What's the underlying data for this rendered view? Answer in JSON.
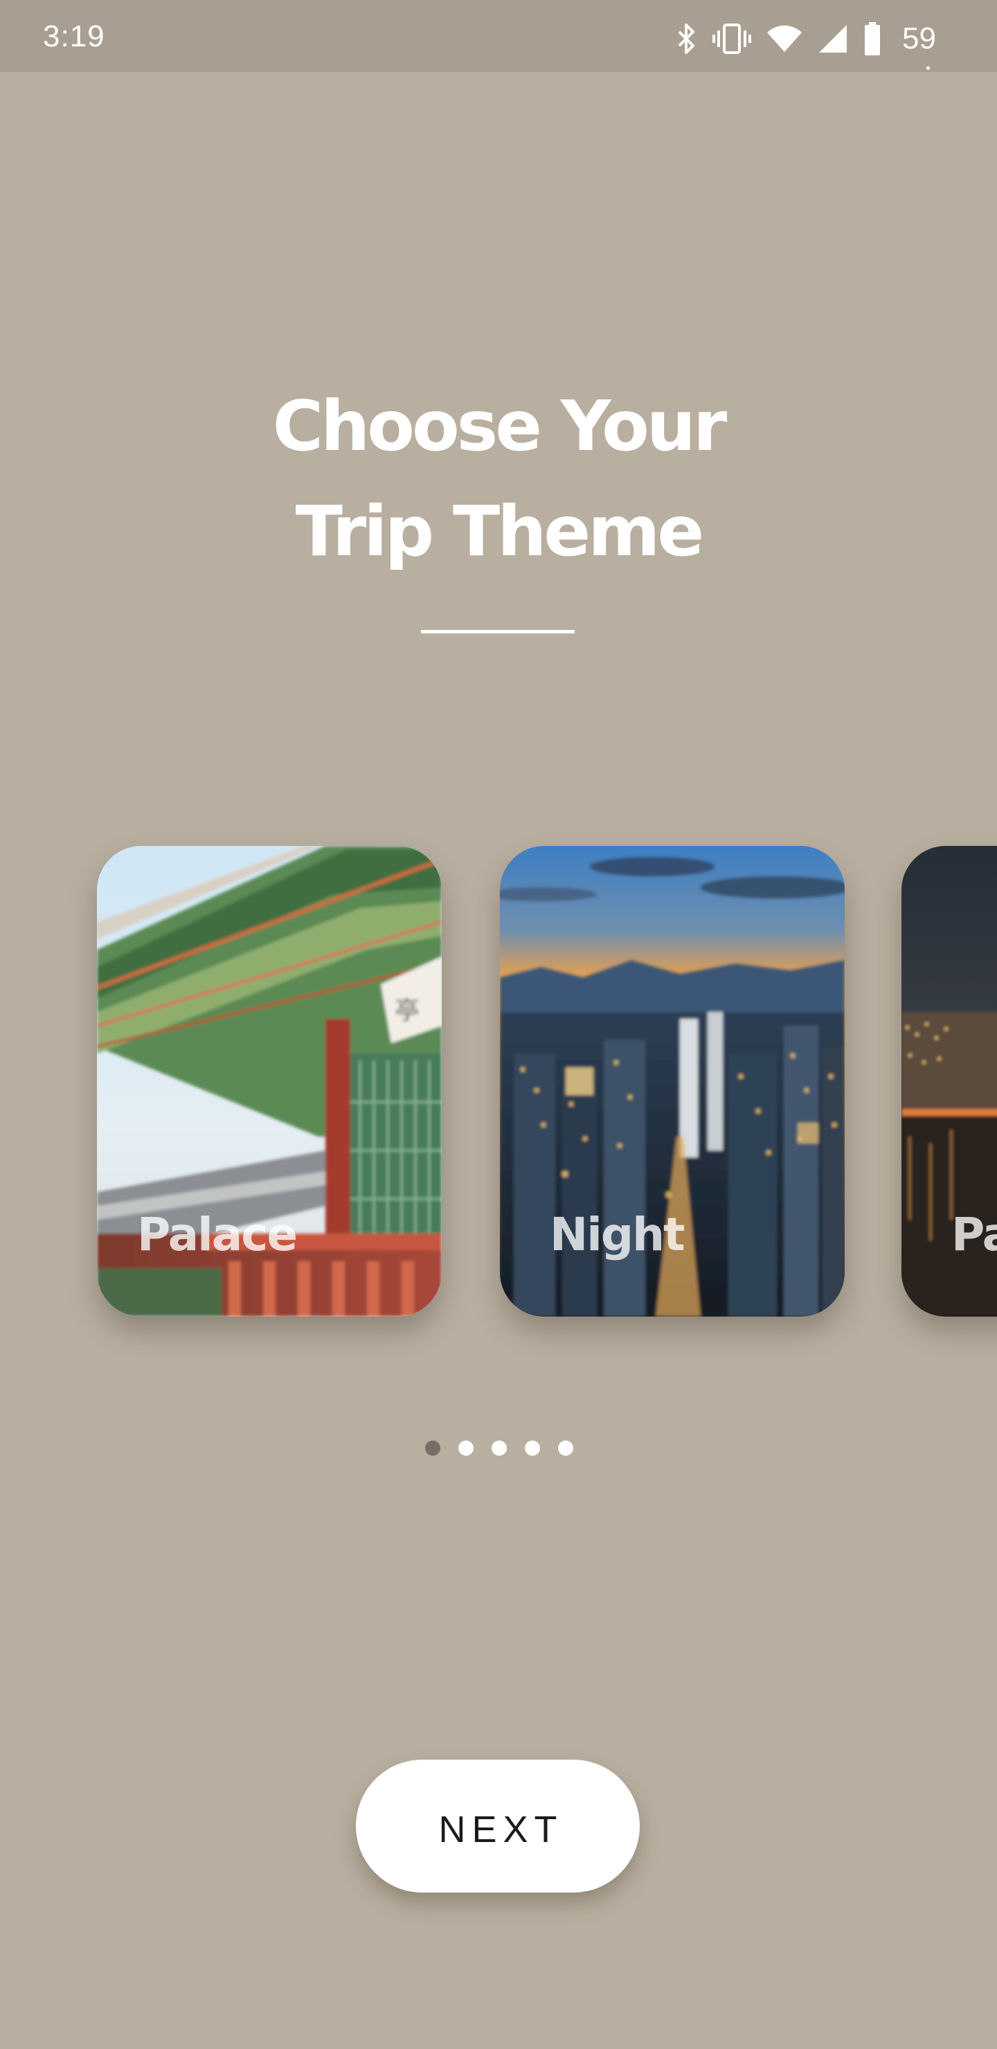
{
  "status_bar": {
    "time": "3:19",
    "battery_percent": "59",
    "icons": [
      "bluetooth-icon",
      "vibrate-icon",
      "wifi-icon",
      "cell-signal-icon",
      "battery-icon"
    ]
  },
  "title": {
    "line1": "Choose Your",
    "line2": "Trip Theme"
  },
  "carousel": {
    "cards": [
      {
        "label": "Palace"
      },
      {
        "label": "Night"
      },
      {
        "label": "Pa"
      }
    ]
  },
  "pagination": {
    "total": 5,
    "active_index": 0
  },
  "next_button": {
    "label": "NEXT"
  },
  "colors": {
    "background": "#b9afa0",
    "status_bar": "#a89f92",
    "active_dot": "#766e67",
    "button": "#ffffff"
  }
}
